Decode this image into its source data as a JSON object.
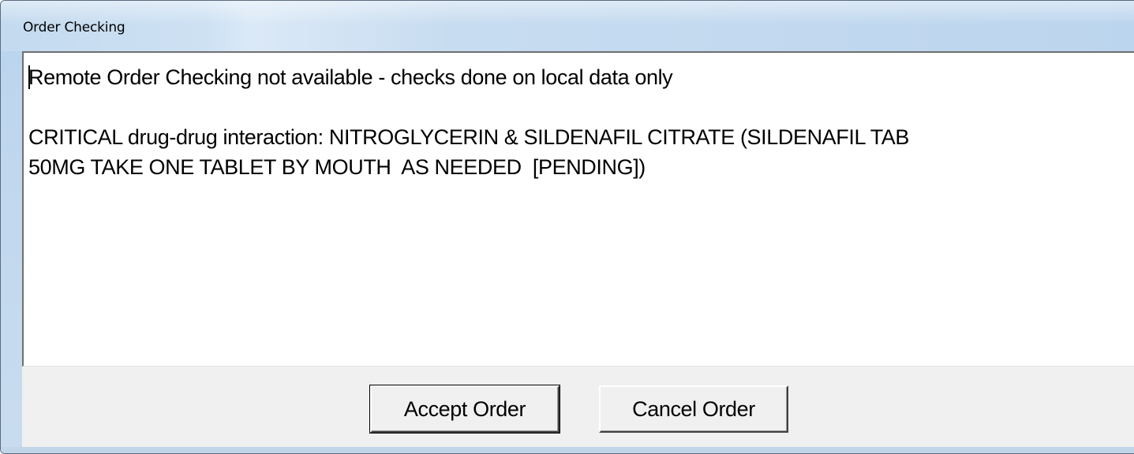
{
  "window": {
    "title": "Order Checking"
  },
  "memo": {
    "lines": [
      "Remote Order Checking not available - checks done on local data only",
      "",
      "CRITICAL drug-drug interaction: NITROGLYCERIN & SILDENAFIL CITRATE (SILDENAFIL TAB",
      "50MG TAKE ONE TABLET BY MOUTH  AS NEEDED  [PENDING])"
    ]
  },
  "buttons": {
    "accept_label": "Accept Order",
    "cancel_label": "Cancel Order"
  },
  "colors": {
    "titlebar": "#bcd5ee",
    "dialog_face": "#f0f0f0",
    "memo_background": "#ffffff"
  }
}
